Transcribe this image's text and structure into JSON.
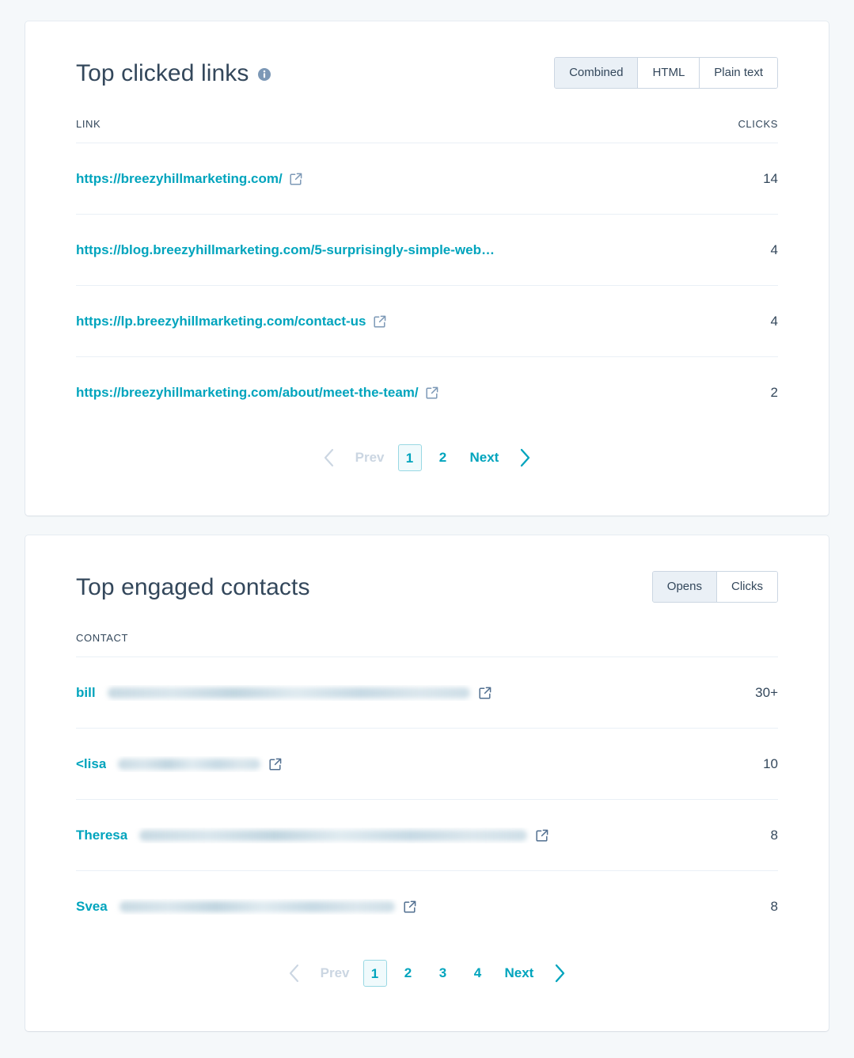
{
  "colors": {
    "page_background": "#f5f8fa",
    "card_background": "#ffffff",
    "link": "#00a4bd",
    "text": "#33475b",
    "border": "#cbd6e2",
    "divider": "#eaf0f6",
    "toggle_active_bg": "#eaf0f6"
  },
  "links_card": {
    "title": "Top clicked links",
    "info_icon": "info-circle-icon",
    "toggles": [
      {
        "label": "Combined",
        "active": true
      },
      {
        "label": "HTML",
        "active": false
      },
      {
        "label": "Plain text",
        "active": false
      }
    ],
    "columns": {
      "link": "LINK",
      "clicks": "CLICKS"
    },
    "rows": [
      {
        "url": "https://breezyhillmarketing.com/",
        "clicks": "14",
        "has_external_icon": true,
        "truncated": false
      },
      {
        "url": "https://blog.breezyhillmarketing.com/5-surprisingly-simple-web…",
        "clicks": "4",
        "has_external_icon": false,
        "truncated": true
      },
      {
        "url": "https://lp.breezyhillmarketing.com/contact-us",
        "clicks": "4",
        "has_external_icon": true,
        "truncated": false
      },
      {
        "url": "https://breezyhillmarketing.com/about/meet-the-team/",
        "clicks": "2",
        "has_external_icon": true,
        "truncated": false
      }
    ],
    "pagination": {
      "prev_icon": "chevron-left-icon",
      "prev_label": "Prev",
      "pages": [
        "1",
        "2"
      ],
      "current_page": "1",
      "next_label": "Next",
      "next_icon": "chevron-right-icon"
    }
  },
  "contacts_card": {
    "title": "Top engaged contacts",
    "toggles": [
      {
        "label": "Opens",
        "active": true
      },
      {
        "label": "Clicks",
        "active": false
      }
    ],
    "columns": {
      "contact": "CONTACT",
      "value": ""
    },
    "rows": [
      {
        "name": "bill",
        "email_redacted": true,
        "redacted_width": 458,
        "value": "30+",
        "has_external_icon": true
      },
      {
        "name": "<lisa",
        "email_redacted": true,
        "redacted_width": 180,
        "value": "10",
        "has_external_icon": true
      },
      {
        "name": "Theresa",
        "email_redacted": true,
        "redacted_width": 490,
        "value": "8",
        "has_external_icon": true
      },
      {
        "name": "Svea",
        "email_redacted": true,
        "redacted_width": 348,
        "value": "8",
        "has_external_icon": true
      }
    ],
    "pagination": {
      "prev_icon": "chevron-left-icon",
      "prev_label": "Prev",
      "pages": [
        "1",
        "2",
        "3",
        "4"
      ],
      "current_page": "1",
      "next_label": "Next",
      "next_icon": "chevron-right-icon"
    }
  }
}
